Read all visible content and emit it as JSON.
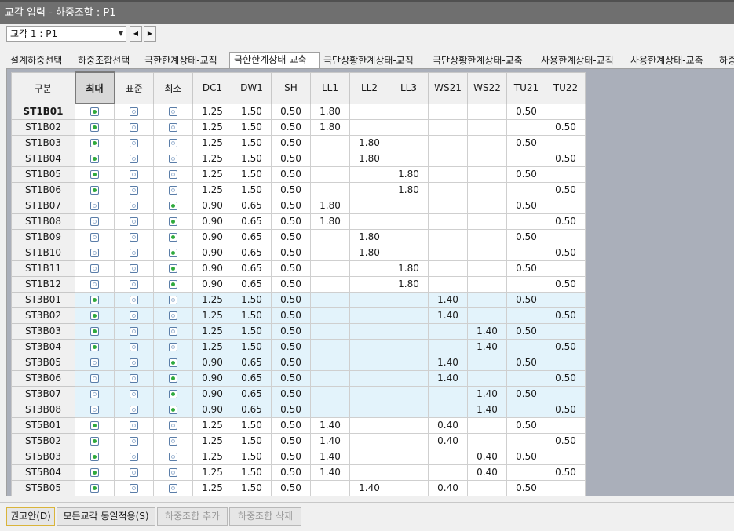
{
  "window": {
    "title": "교각 입력 - 하중조합 : P1"
  },
  "toolbar": {
    "pier_select": "교각 1 : P1",
    "prev_icon": "◀",
    "next_icon": "▶"
  },
  "tabs": [
    "설계하중선택",
    "하중조합선택",
    "극한한계상태-교직",
    "극한한계상태-교축",
    "극단상황한계상태-교직",
    "극단상황한계상태-교축",
    "사용한계상태-교직",
    "사용한계상태-교축",
    "하중"
  ],
  "active_tab": 3,
  "grid": {
    "columns": [
      "구분",
      "최대",
      "표준",
      "최소",
      "DC1",
      "DW1",
      "SH",
      "LL1",
      "LL2",
      "LL3",
      "WS21",
      "WS22",
      "TU21",
      "TU22"
    ],
    "selected_column": 1,
    "rows": [
      {
        "name": "ST1B01",
        "sel": 0,
        "dc1": "1.25",
        "dw1": "1.50",
        "sh": "0.50",
        "ll1": "1.80",
        "ll2": "",
        "ll3": "",
        "ws21": "",
        "ws22": "",
        "tu21": "0.50",
        "tu22": ""
      },
      {
        "name": "ST1B02",
        "sel": 0,
        "dc1": "1.25",
        "dw1": "1.50",
        "sh": "0.50",
        "ll1": "1.80",
        "ll2": "",
        "ll3": "",
        "ws21": "",
        "ws22": "",
        "tu21": "",
        "tu22": "0.50"
      },
      {
        "name": "ST1B03",
        "sel": 0,
        "dc1": "1.25",
        "dw1": "1.50",
        "sh": "0.50",
        "ll1": "",
        "ll2": "1.80",
        "ll3": "",
        "ws21": "",
        "ws22": "",
        "tu21": "0.50",
        "tu22": ""
      },
      {
        "name": "ST1B04",
        "sel": 0,
        "dc1": "1.25",
        "dw1": "1.50",
        "sh": "0.50",
        "ll1": "",
        "ll2": "1.80",
        "ll3": "",
        "ws21": "",
        "ws22": "",
        "tu21": "",
        "tu22": "0.50"
      },
      {
        "name": "ST1B05",
        "sel": 0,
        "dc1": "1.25",
        "dw1": "1.50",
        "sh": "0.50",
        "ll1": "",
        "ll2": "",
        "ll3": "1.80",
        "ws21": "",
        "ws22": "",
        "tu21": "0.50",
        "tu22": ""
      },
      {
        "name": "ST1B06",
        "sel": 0,
        "dc1": "1.25",
        "dw1": "1.50",
        "sh": "0.50",
        "ll1": "",
        "ll2": "",
        "ll3": "1.80",
        "ws21": "",
        "ws22": "",
        "tu21": "",
        "tu22": "0.50"
      },
      {
        "name": "ST1B07",
        "sel": 2,
        "dc1": "0.90",
        "dw1": "0.65",
        "sh": "0.50",
        "ll1": "1.80",
        "ll2": "",
        "ll3": "",
        "ws21": "",
        "ws22": "",
        "tu21": "0.50",
        "tu22": ""
      },
      {
        "name": "ST1B08",
        "sel": 2,
        "dc1": "0.90",
        "dw1": "0.65",
        "sh": "0.50",
        "ll1": "1.80",
        "ll2": "",
        "ll3": "",
        "ws21": "",
        "ws22": "",
        "tu21": "",
        "tu22": "0.50"
      },
      {
        "name": "ST1B09",
        "sel": 2,
        "dc1": "0.90",
        "dw1": "0.65",
        "sh": "0.50",
        "ll1": "",
        "ll2": "1.80",
        "ll3": "",
        "ws21": "",
        "ws22": "",
        "tu21": "0.50",
        "tu22": ""
      },
      {
        "name": "ST1B10",
        "sel": 2,
        "dc1": "0.90",
        "dw1": "0.65",
        "sh": "0.50",
        "ll1": "",
        "ll2": "1.80",
        "ll3": "",
        "ws21": "",
        "ws22": "",
        "tu21": "",
        "tu22": "0.50"
      },
      {
        "name": "ST1B11",
        "sel": 2,
        "dc1": "0.90",
        "dw1": "0.65",
        "sh": "0.50",
        "ll1": "",
        "ll2": "",
        "ll3": "1.80",
        "ws21": "",
        "ws22": "",
        "tu21": "0.50",
        "tu22": ""
      },
      {
        "name": "ST1B12",
        "sel": 2,
        "dc1": "0.90",
        "dw1": "0.65",
        "sh": "0.50",
        "ll1": "",
        "ll2": "",
        "ll3": "1.80",
        "ws21": "",
        "ws22": "",
        "tu21": "",
        "tu22": "0.50"
      },
      {
        "name": "ST3B01",
        "sel": 0,
        "dc1": "1.25",
        "dw1": "1.50",
        "sh": "0.50",
        "ll1": "",
        "ll2": "",
        "ll3": "",
        "ws21": "1.40",
        "ws22": "",
        "tu21": "0.50",
        "tu22": ""
      },
      {
        "name": "ST3B02",
        "sel": 0,
        "dc1": "1.25",
        "dw1": "1.50",
        "sh": "0.50",
        "ll1": "",
        "ll2": "",
        "ll3": "",
        "ws21": "1.40",
        "ws22": "",
        "tu21": "",
        "tu22": "0.50"
      },
      {
        "name": "ST3B03",
        "sel": 0,
        "dc1": "1.25",
        "dw1": "1.50",
        "sh": "0.50",
        "ll1": "",
        "ll2": "",
        "ll3": "",
        "ws21": "",
        "ws22": "1.40",
        "tu21": "0.50",
        "tu22": ""
      },
      {
        "name": "ST3B04",
        "sel": 0,
        "dc1": "1.25",
        "dw1": "1.50",
        "sh": "0.50",
        "ll1": "",
        "ll2": "",
        "ll3": "",
        "ws21": "",
        "ws22": "1.40",
        "tu21": "",
        "tu22": "0.50"
      },
      {
        "name": "ST3B05",
        "sel": 2,
        "dc1": "0.90",
        "dw1": "0.65",
        "sh": "0.50",
        "ll1": "",
        "ll2": "",
        "ll3": "",
        "ws21": "1.40",
        "ws22": "",
        "tu21": "0.50",
        "tu22": ""
      },
      {
        "name": "ST3B06",
        "sel": 2,
        "dc1": "0.90",
        "dw1": "0.65",
        "sh": "0.50",
        "ll1": "",
        "ll2": "",
        "ll3": "",
        "ws21": "1.40",
        "ws22": "",
        "tu21": "",
        "tu22": "0.50"
      },
      {
        "name": "ST3B07",
        "sel": 2,
        "dc1": "0.90",
        "dw1": "0.65",
        "sh": "0.50",
        "ll1": "",
        "ll2": "",
        "ll3": "",
        "ws21": "",
        "ws22": "1.40",
        "tu21": "0.50",
        "tu22": ""
      },
      {
        "name": "ST3B08",
        "sel": 2,
        "dc1": "0.90",
        "dw1": "0.65",
        "sh": "0.50",
        "ll1": "",
        "ll2": "",
        "ll3": "",
        "ws21": "",
        "ws22": "1.40",
        "tu21": "",
        "tu22": "0.50"
      },
      {
        "name": "ST5B01",
        "sel": 0,
        "dc1": "1.25",
        "dw1": "1.50",
        "sh": "0.50",
        "ll1": "1.40",
        "ll2": "",
        "ll3": "",
        "ws21": "0.40",
        "ws22": "",
        "tu21": "0.50",
        "tu22": ""
      },
      {
        "name": "ST5B02",
        "sel": 0,
        "dc1": "1.25",
        "dw1": "1.50",
        "sh": "0.50",
        "ll1": "1.40",
        "ll2": "",
        "ll3": "",
        "ws21": "0.40",
        "ws22": "",
        "tu21": "",
        "tu22": "0.50"
      },
      {
        "name": "ST5B03",
        "sel": 0,
        "dc1": "1.25",
        "dw1": "1.50",
        "sh": "0.50",
        "ll1": "1.40",
        "ll2": "",
        "ll3": "",
        "ws21": "",
        "ws22": "0.40",
        "tu21": "0.50",
        "tu22": ""
      },
      {
        "name": "ST5B04",
        "sel": 0,
        "dc1": "1.25",
        "dw1": "1.50",
        "sh": "0.50",
        "ll1": "1.40",
        "ll2": "",
        "ll3": "",
        "ws21": "",
        "ws22": "0.40",
        "tu21": "",
        "tu22": "0.50"
      },
      {
        "name": "ST5B05",
        "sel": 0,
        "dc1": "1.25",
        "dw1": "1.50",
        "sh": "0.50",
        "ll1": "",
        "ll2": "1.40",
        "ll3": "",
        "ws21": "0.40",
        "ws22": "",
        "tu21": "0.50",
        "tu22": ""
      }
    ]
  },
  "buttons": {
    "recommend": "권고안(D)",
    "apply_all": "모든교각 동일적용(S)",
    "add_combo": "하중조합 추가",
    "delete_combo": "하중조합 삭제"
  }
}
